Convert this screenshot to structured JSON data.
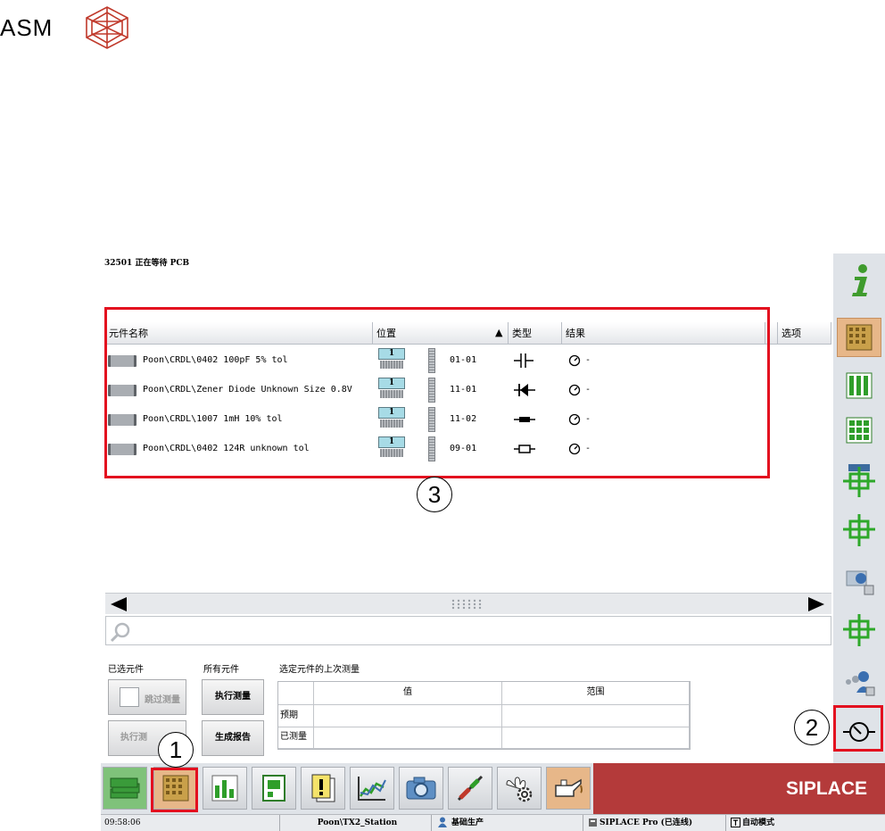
{
  "logo": {
    "text": "ASM"
  },
  "status_line": "32501 正在等待 PCB",
  "table": {
    "columns": [
      "元件名称",
      "位置",
      "类型",
      "结果",
      "选项"
    ],
    "sort_indicator": "▲",
    "rows": [
      {
        "name": "Poon\\CRDL\\0402 100pF 5% tol",
        "badge": "1",
        "position": "01-01",
        "type_icon": "capacitor-icon",
        "result": "-"
      },
      {
        "name": "Poon\\CRDL\\Zener Diode Unknown Size 0.8V",
        "badge": "1",
        "position": "11-01",
        "type_icon": "diode-icon",
        "result": "-"
      },
      {
        "name": "Poon\\CRDL\\1007 1mH 10% tol",
        "badge": "1",
        "position": "11-02",
        "type_icon": "inductor-icon",
        "result": "-"
      },
      {
        "name": "Poon\\CRDL\\0402 124R unknown tol",
        "badge": "1",
        "position": "09-01",
        "type_icon": "resistor-icon",
        "result": "-"
      }
    ]
  },
  "bottom": {
    "selected_label": "已选元件",
    "all_label": "所有元件",
    "last_meas_label": "选定元件的上次测量",
    "skip_button": "跳过测量",
    "exec_partial_button": "执行测",
    "exec_button": "执行测量",
    "report_button": "生成报告",
    "meas_table": {
      "headers": [
        "值",
        "范围"
      ],
      "row_labels": [
        "预期",
        "已测量"
      ]
    }
  },
  "taskbar": {
    "brand": "SIPLACE"
  },
  "statusbar": {
    "time": "09:58:06",
    "station": "Poon\\TX2_Station",
    "user_mode": "基础生产",
    "connection": "SIPLACE Pro (已连线)",
    "mode": "自动模式"
  },
  "callouts": [
    "1",
    "2",
    "3"
  ],
  "colors": {
    "accent": "#e3101f",
    "brand": "#b43a3a",
    "active_tab": "#e7b789"
  }
}
